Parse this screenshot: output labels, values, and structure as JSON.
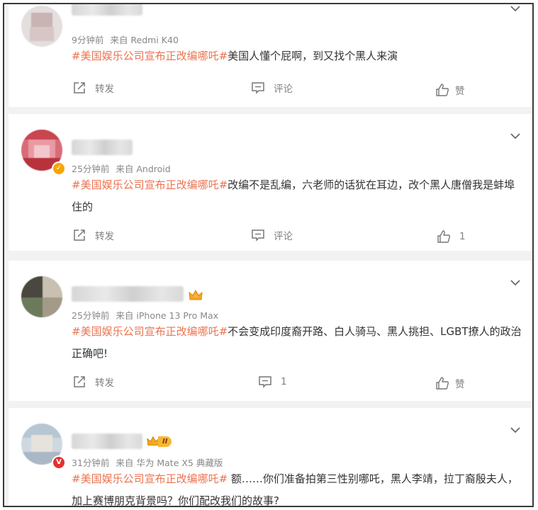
{
  "feed": {
    "comments": [
      {
        "time": "9分钟前",
        "source": "来自 Redmi K40",
        "hashtag": "#美国娱乐公司宣布正改编哪吒#",
        "body": "美国人懂个屁啊，到又找个黑人来演",
        "repost_label": "转发",
        "comment_label": "评论",
        "like_label": "赞"
      },
      {
        "time": "25分钟前",
        "source": "来自 Android",
        "hashtag": "#美国娱乐公司宣布正改编哪吒#",
        "body": "改编不是乱编，六老师的话犹在耳边，改个黑人唐僧我是蚌埠住的",
        "repost_label": "转发",
        "comment_label": "评论",
        "like_count": "1"
      },
      {
        "time": "25分钟前",
        "source": "来自 iPhone 13 Pro Max",
        "hashtag": "#美国娱乐公司宣布正改编哪吒#",
        "body": "不会变成印度裔开路、白人骑马、黑人挑担、LGBT撩人的政治正确吧!",
        "repost_label": "转发",
        "comment_count": "1",
        "like_label": "赞"
      },
      {
        "time": "31分钟前",
        "source": "来自 华为 Mate X5 典藏版",
        "hashtag": "#美国娱乐公司宣布正改编哪吒#",
        "body": " 额……你们准备拍第三性别哪吒，黑人李靖，拉丁裔殷夫人，加上赛博朋克背景吗？你们配改我们的故事?"
      }
    ],
    "badge_level": "II"
  },
  "colors": {
    "hashtag": "#eb7350",
    "meta": "#888888",
    "verified_gold": "#f7a600",
    "verified_red": "#e3312e"
  },
  "icons": [
    "repost-icon",
    "comment-icon",
    "like-icon",
    "chevron-down-icon",
    "crown-icon",
    "verified-badge"
  ]
}
